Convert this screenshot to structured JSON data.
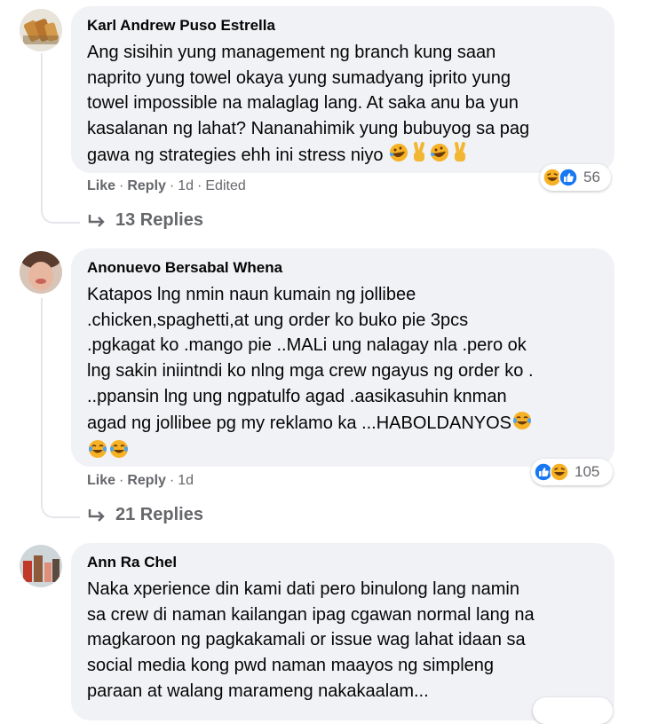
{
  "comments": [
    {
      "author": "Karl Andrew Puso Estrella",
      "text": "Ang sisihin yung management ng branch kung saan\nnaprito yung towel okaya yung sumadyang iprito yung\ntowel impossible na malaglag lang. At saka anu ba yun\nkasalanan ng lahat? Nananahimik yung bubuyog sa pag\ngawa ng strategies ehh ini stress niyo",
      "trailing_emojis": [
        "rolling-laugh-emoji",
        "victory-hand-emoji",
        "rolling-laugh-emoji",
        "victory-hand-emoji"
      ],
      "actions": {
        "like": "Like",
        "reply": "Reply",
        "time": "1d",
        "edited": "Edited"
      },
      "reactions": {
        "icons": [
          "haha-icon",
          "like-icon"
        ],
        "count": "56"
      },
      "replies": "13 Replies"
    },
    {
      "author": "Anonuevo Bersabal Whena",
      "text": "Katapos lng nmin naun kumain ng jollibee\n.chicken,spaghetti,at ung order ko buko pie 3pcs\n.pgkagat ko .mango pie ..MALi ung nalagay nla .pero ok\nlng sakin iniintndi ko nlng mga crew ngayus ng order ko .\n..ppansin lng ung ngpatulfo agad .aasikasuhin knman\nagad ng jollibee pg my reklamo ka ...HABOLDANYOS",
      "trailing_emojis": [
        "tears-of-joy-emoji",
        "tears-of-joy-emoji",
        "tears-of-joy-emoji"
      ],
      "actions": {
        "like": "Like",
        "reply": "Reply",
        "time": "1d"
      },
      "reactions": {
        "icons": [
          "like-icon",
          "haha-icon"
        ],
        "count": "105"
      },
      "replies": "21 Replies"
    },
    {
      "author": "Ann Ra Chel",
      "text": "Naka xperience din kami dati pero binulong lang namin\nsa crew di naman kailangan ipag cgawan normal lang na\nmagkaroon ng pagkakamali or issue wag lahat idaan sa\nsocial media kong pwd naman maayos ng simpleng\nparaan at walang marameng nakakaalam..."
    }
  ],
  "separator": "·",
  "colors": {
    "bubble": "#f0f2f5",
    "secondary_text": "#65676b",
    "like_blue": "#1877f2",
    "haha_yellow": "#f7b125"
  }
}
